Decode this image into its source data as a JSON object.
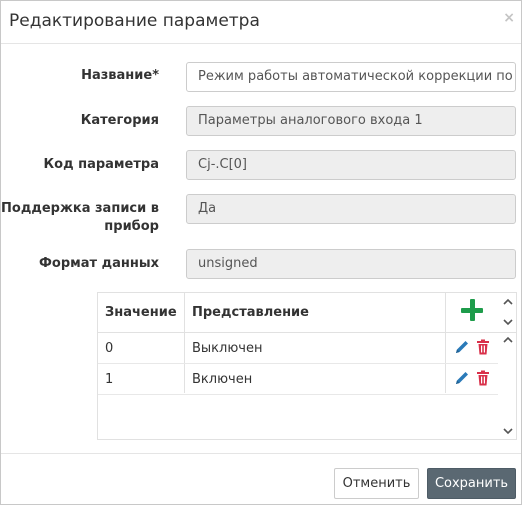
{
  "dialog": {
    "title": "Редактирование параметра",
    "close_label": "×"
  },
  "form": {
    "name_label": "Название*",
    "name_value": "Режим работы автоматической коррекции по температуре",
    "category_label": "Категория",
    "category_value": "Параметры аналогового входа 1",
    "code_label": "Код параметра",
    "code_value": "Cj-.C[0]",
    "support_label": "Поддержка записи в прибор",
    "support_value": "Да",
    "format_label": "Формат данных",
    "format_value": "unsigned"
  },
  "table": {
    "headers": [
      "Значение",
      "Представление"
    ],
    "rows": [
      {
        "value": "0",
        "repr": "Выключен"
      },
      {
        "value": "1",
        "repr": "Включен"
      }
    ],
    "icons": {
      "add": "plus-icon",
      "edit": "pencil-icon",
      "delete": "trash-icon",
      "up": "chevron-up-icon",
      "down": "chevron-down-icon"
    },
    "colors": {
      "add": "#1e9c4b",
      "edit": "#2a7ab8",
      "delete": "#d9304a"
    }
  },
  "footer": {
    "cancel_label": "Отменить",
    "save_label": "Сохранить"
  }
}
